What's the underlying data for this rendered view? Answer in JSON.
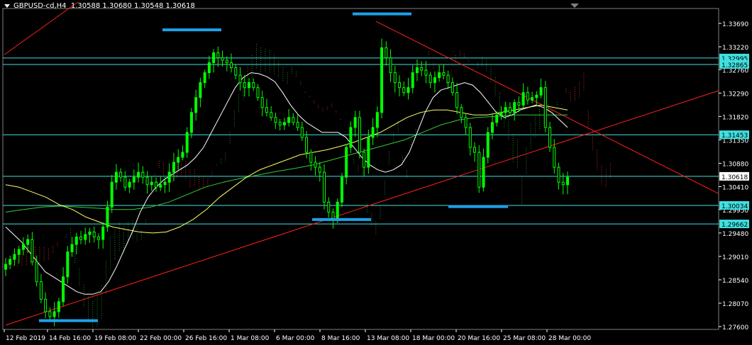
{
  "header": {
    "symbol": "GBPUSD-cd,H4",
    "ohlc": "1.30588 1.30680 1.30548 1.30618"
  },
  "colors": {
    "background": "#000000",
    "candle": "#00ff00",
    "axis": "#ffffff",
    "hline": "#40e0e0",
    "trend": "#ff2020",
    "marker": "#1ea0e8",
    "ma_fast": "#ffffff",
    "ma_mid": "#ffff66",
    "ma_slow": "#33cc33",
    "cloud_bear": "#ff3030",
    "cloud_bull": "#2ea02e"
  },
  "chart_data": {
    "type": "candlestick",
    "title": "GBPUSD-cd,H4",
    "x_tick_labels": [
      "12 Feb 2019",
      "14 Feb 16:00",
      "19 Feb 08:00",
      "22 Feb 00:00",
      "26 Feb 16:00",
      "1 Mar 08:00",
      "6 Mar 00:00",
      "8 Mar 16:00",
      "13 Mar 08:00",
      "18 Mar 00:00",
      "20 Mar 16:00",
      "25 Mar 08:00",
      "28 Mar 00:00"
    ],
    "y_ticks": [
      1.3369,
      1.3322,
      1.3276,
      1.3229,
      1.3182,
      1.3135,
      1.3088,
      1.3041,
      1.2995,
      1.2948,
      1.2901,
      1.2854,
      1.2807,
      1.276
    ],
    "ylim": [
      1.2755,
      1.3395
    ],
    "horizontal_levels": [
      1.32995,
      1.32865,
      1.31453,
      1.30618,
      1.30034,
      1.29662
    ],
    "level_labels": [
      "1.32995",
      "1.32865",
      "1.31453",
      "1.30618",
      "1.30034",
      "1.29662"
    ],
    "close": [
      1.2885,
      1.2895,
      1.2905,
      1.2915,
      1.2925,
      1.2935,
      1.289,
      1.285,
      1.2815,
      1.279,
      1.278,
      1.279,
      1.281,
      1.286,
      1.291,
      1.2925,
      1.294,
      1.2935,
      1.2945,
      1.295,
      1.294,
      1.2935,
      1.296,
      1.3,
      1.305,
      1.307,
      1.306,
      1.304,
      1.305,
      1.306,
      1.307,
      1.306,
      1.3045,
      1.305,
      1.304,
      1.3045,
      1.305,
      1.307,
      1.309,
      1.31,
      1.311,
      1.315,
      1.319,
      1.322,
      1.325,
      1.327,
      1.329,
      1.331,
      1.33,
      1.3295,
      1.329,
      1.328,
      1.3265,
      1.325,
      1.324,
      1.325,
      1.324,
      1.322,
      1.32,
      1.319,
      1.318,
      1.317,
      1.3165,
      1.317,
      1.318,
      1.317,
      1.316,
      1.314,
      1.311,
      1.309,
      1.308,
      1.307,
      1.301,
      1.299,
      1.2975,
      1.301,
      1.306,
      1.312,
      1.316,
      1.318,
      1.311,
      1.308,
      1.314,
      1.316,
      1.319,
      1.332,
      1.33,
      1.327,
      1.325,
      1.324,
      1.323,
      1.324,
      1.327,
      1.328,
      1.3275,
      1.3265,
      1.325,
      1.326,
      1.327,
      1.3265,
      1.325,
      1.323,
      1.32,
      1.318,
      1.316,
      1.312,
      1.311,
      1.304,
      1.31,
      1.315,
      1.317,
      1.3185,
      1.319,
      1.32,
      1.319,
      1.321,
      1.3205,
      1.323,
      1.3215,
      1.322,
      1.3225,
      1.324,
      1.316,
      1.312,
      1.308,
      1.305,
      1.3045,
      1.306
    ],
    "ma_fast": [
      1.296,
      1.2945,
      1.293,
      1.291,
      1.289,
      1.287,
      1.286,
      1.285,
      1.284,
      1.283,
      1.2825,
      1.2825,
      1.283,
      1.285,
      1.288,
      1.2915,
      1.295,
      1.299,
      1.302,
      1.304,
      1.3055,
      1.3065,
      1.3075,
      1.3085,
      1.31,
      1.312,
      1.315,
      1.318,
      1.321,
      1.324,
      1.326,
      1.327,
      1.3268,
      1.3262,
      1.3252,
      1.323,
      1.3205,
      1.3185,
      1.317,
      1.316,
      1.315,
      1.315,
      1.315,
      1.314,
      1.312,
      1.31,
      1.3085,
      1.3075,
      1.307,
      1.3075,
      1.3085,
      1.311,
      1.315,
      1.319,
      1.322,
      1.3235,
      1.324,
      1.3245,
      1.325,
      1.3245,
      1.323,
      1.321,
      1.319,
      1.318,
      1.3185,
      1.3195,
      1.32,
      1.3205,
      1.32,
      1.319,
      1.3175,
      1.316
    ],
    "ma_mid": [
      1.3045,
      1.304,
      1.303,
      1.302,
      1.3005,
      1.2995,
      1.298,
      1.297,
      1.296,
      1.2955,
      1.295,
      1.2948,
      1.295,
      1.296,
      1.2975,
      1.2995,
      1.302,
      1.304,
      1.306,
      1.3075,
      1.3085,
      1.3095,
      1.3105,
      1.311,
      1.3115,
      1.3122,
      1.313,
      1.314,
      1.315,
      1.3165,
      1.318,
      1.319,
      1.3195,
      1.3195,
      1.319,
      1.3185,
      1.3185,
      1.319,
      1.3195,
      1.32,
      1.3205,
      1.32,
      1.3195
    ],
    "ma_slow": [
      1.299,
      1.2995,
      1.3,
      1.3002,
      1.3,
      1.2998,
      1.2995,
      1.2995,
      1.3,
      1.301,
      1.3025,
      1.304,
      1.305,
      1.3058,
      1.3065,
      1.3072,
      1.3078,
      1.3085,
      1.3095,
      1.3105,
      1.3115,
      1.3125,
      1.3135,
      1.315,
      1.3165,
      1.3175,
      1.318,
      1.3182,
      1.3185,
      1.3185,
      1.3185,
      1.3185
    ]
  }
}
